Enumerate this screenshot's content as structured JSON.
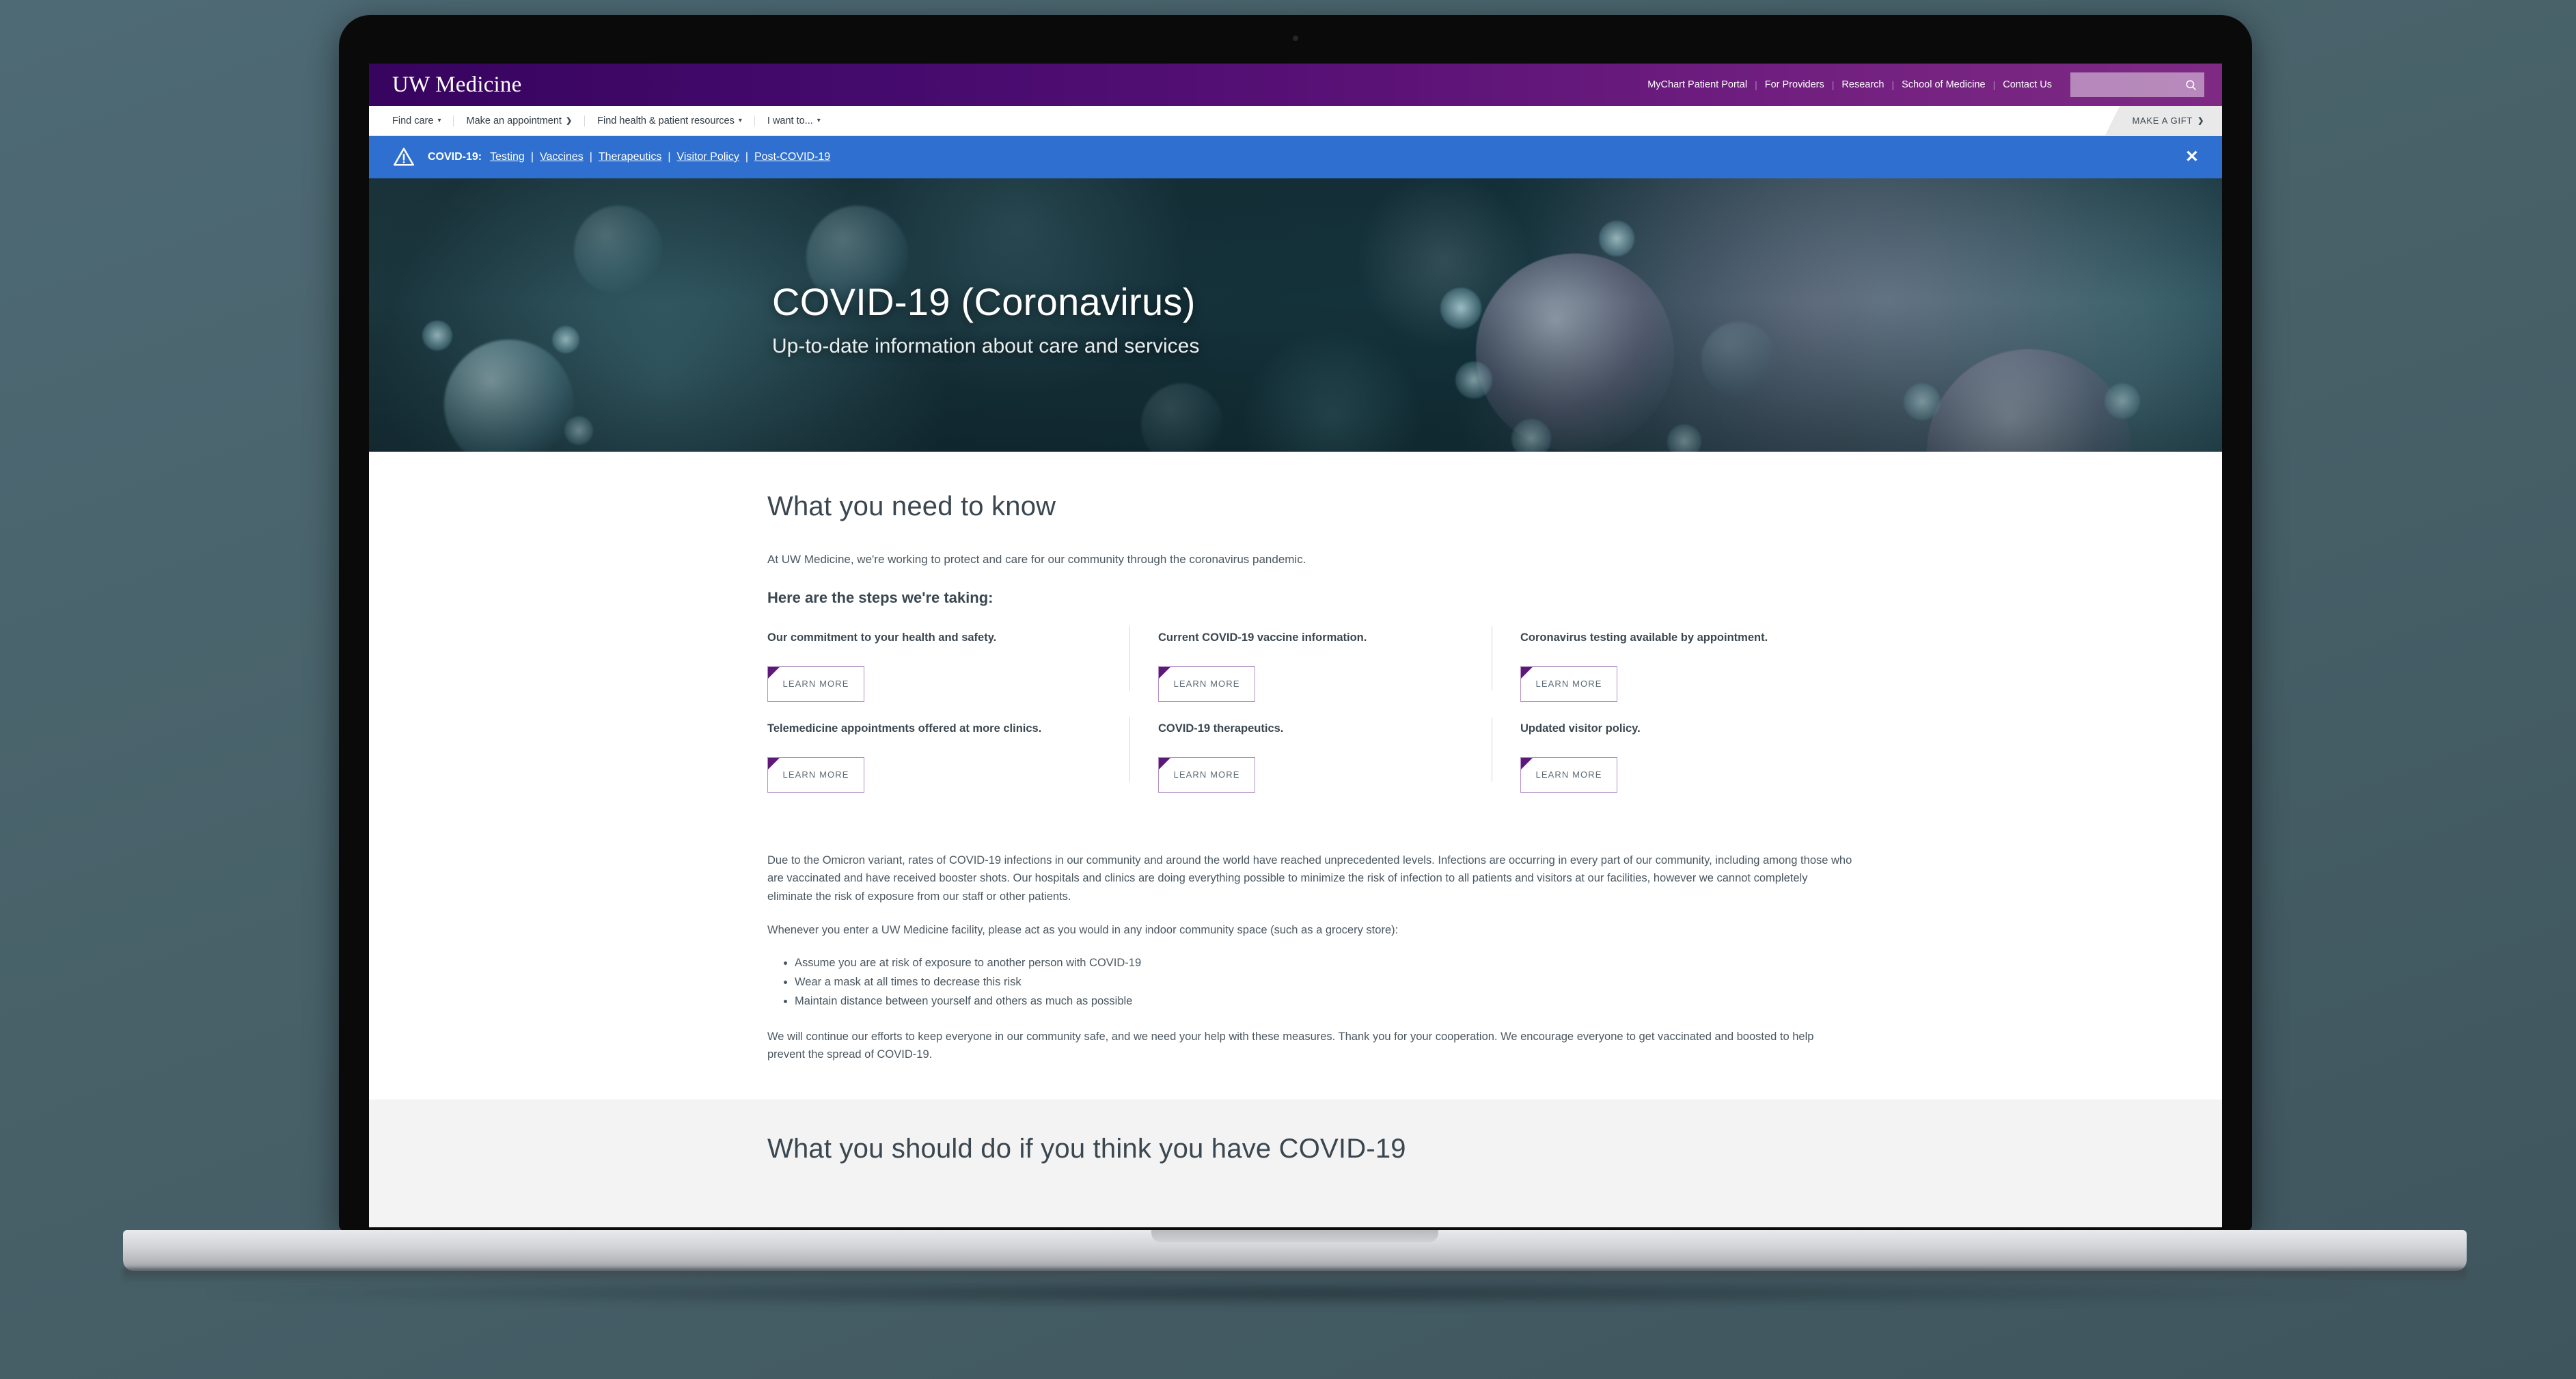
{
  "header": {
    "logo": "UW Medicine",
    "util_links": [
      {
        "label": "MyChart Patient Portal"
      },
      {
        "label": "For Providers"
      },
      {
        "label": "Research"
      },
      {
        "label": "School of Medicine"
      },
      {
        "label": "Contact Us"
      }
    ],
    "search_icon": "search-icon",
    "separator": "|"
  },
  "nav": {
    "items": [
      {
        "label": "Find care",
        "indicator": "▾"
      },
      {
        "label": "Make an appointment",
        "indicator": "❯"
      },
      {
        "label": "Find health & patient resources",
        "indicator": "▾"
      },
      {
        "label": "I want to...",
        "indicator": "▾"
      }
    ],
    "make_gift": "MAKE A GIFT",
    "make_gift_arrow": "❯"
  },
  "alert": {
    "icon": "warning-triangle-icon",
    "label": "COVID-19:",
    "links": [
      "Testing",
      "Vaccines",
      "Therapeutics",
      "Visitor Policy",
      "Post-COVID-19"
    ],
    "separator": "|",
    "close": "✕",
    "bg_color": "#2f6fd0"
  },
  "hero": {
    "title": "COVID-19 (Coronavirus)",
    "subtitle": "Up-to-date information about care and services"
  },
  "main": {
    "section_title": "What you need to know",
    "intro": "At UW Medicine, we're working to protect and care for our community through the coronavirus pandemic.",
    "steps_title": "Here are the steps we're taking:",
    "cards": [
      {
        "title": "Our commitment to your health and safety.",
        "button": "LEARN MORE"
      },
      {
        "title": "Current COVID-19 vaccine information.",
        "button": "LEARN MORE"
      },
      {
        "title": "Coronavirus testing available by appointment.",
        "button": "LEARN MORE"
      },
      {
        "title": "Telemedicine appointments offered at more clinics.",
        "button": "LEARN MORE"
      },
      {
        "title": "COVID-19 therapeutics.",
        "button": "LEARN MORE"
      },
      {
        "title": "Updated visitor policy.",
        "button": "LEARN MORE"
      }
    ],
    "paragraph_omicron": "Due to the Omicron variant, rates of COVID-19 infections in our community and around the world have reached unprecedented levels. Infections are occurring in every part of our community, including among those who are vaccinated and have received booster shots. Our hospitals and clinics are doing everything possible to minimize the risk of infection to all patients and visitors at our facilities, however we cannot completely eliminate the risk of exposure from our staff or other patients.",
    "paragraph_whenever": "Whenever you enter a UW Medicine facility, please act as you would in any indoor community space (such as a grocery store):",
    "bullets": [
      "Assume you are at risk of exposure to another person with COVID-19",
      "Wear a mask at all times to decrease this risk",
      "Maintain distance between yourself and others as much as possible"
    ],
    "paragraph_closing": "We will continue our efforts to keep everyone in our community safe, and we need your help with these measures. Thank you for your cooperation.  We encourage everyone to get vaccinated and boosted to help prevent the spread of COVID-19."
  },
  "section_two": {
    "title": "What you should do if you think you have COVID-19"
  },
  "colors": {
    "brand_purple": "#37045f",
    "brand_magenta": "#7e2a85",
    "alert_blue": "#2f6fd0",
    "button_border": "#b38fc4",
    "button_corner": "#5b1a78",
    "text_dark": "#3b4750",
    "text_body": "#4b5760",
    "page_bg": "#4e6a75"
  }
}
